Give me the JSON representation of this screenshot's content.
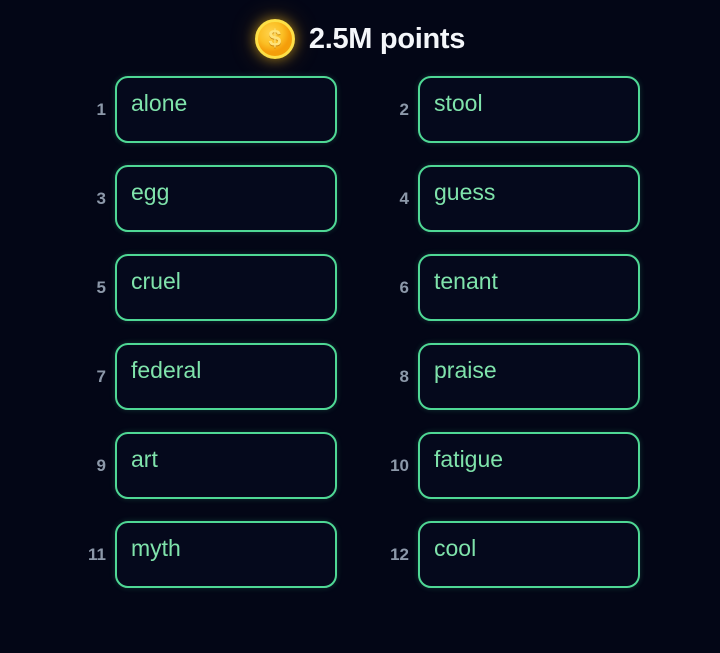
{
  "header": {
    "coin_icon": "dollar-coin-icon",
    "coin_glyph": "$",
    "points_label": "2.5M points"
  },
  "board": {
    "rows": [
      [
        {
          "index": "1",
          "word": "alone"
        },
        {
          "index": "2",
          "word": "stool"
        }
      ],
      [
        {
          "index": "3",
          "word": "egg"
        },
        {
          "index": "4",
          "word": "guess"
        }
      ],
      [
        {
          "index": "5",
          "word": "cruel"
        },
        {
          "index": "6",
          "word": "tenant"
        }
      ],
      [
        {
          "index": "7",
          "word": "federal"
        },
        {
          "index": "8",
          "word": "praise"
        }
      ],
      [
        {
          "index": "9",
          "word": "art"
        },
        {
          "index": "10",
          "word": "fatigue"
        }
      ],
      [
        {
          "index": "11",
          "word": "myth"
        },
        {
          "index": "12",
          "word": "cool"
        }
      ]
    ]
  },
  "colors": {
    "background": "#030616",
    "card_border": "#4fd895",
    "card_fill": "#05091c",
    "word_text": "#7fe3ab",
    "index_text": "#8c98a9",
    "header_text": "#f4f6fa",
    "coin_gold": "#fbbf24",
    "coin_rim": "#fde047"
  }
}
